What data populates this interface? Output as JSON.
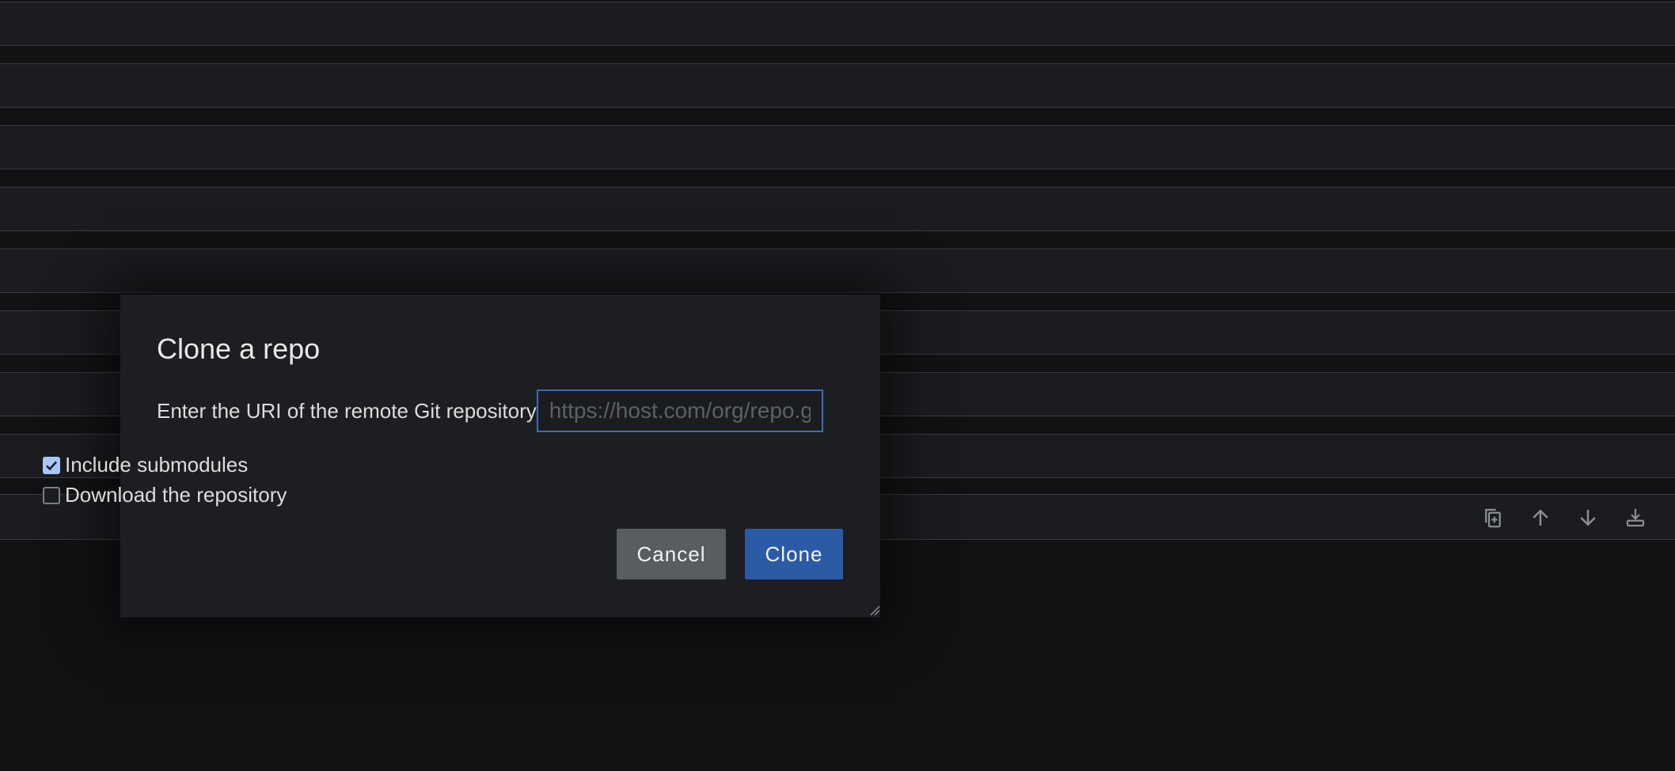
{
  "dialog": {
    "title": "Clone a repo",
    "uri_label": "Enter the URI of the remote Git repository",
    "uri_placeholder": "https://host.com/org/repo.git",
    "uri_value": "",
    "options": [
      {
        "label": "Include submodules",
        "checked": true
      },
      {
        "label": "Download the repository",
        "checked": false
      }
    ],
    "cancel_label": "Cancel",
    "clone_label": "Clone"
  },
  "toolbar": {
    "icons": [
      "duplicate-icon",
      "arrow-up-icon",
      "arrow-down-icon",
      "insert-below-icon",
      "more-icon"
    ]
  },
  "colors": {
    "background": "#111214",
    "row": "#1b1c1f",
    "dialog": "#1d1e21",
    "accent": "#2c5ba6",
    "checkbox_checked": "#a8c7fa",
    "cancel": "#595c61"
  }
}
